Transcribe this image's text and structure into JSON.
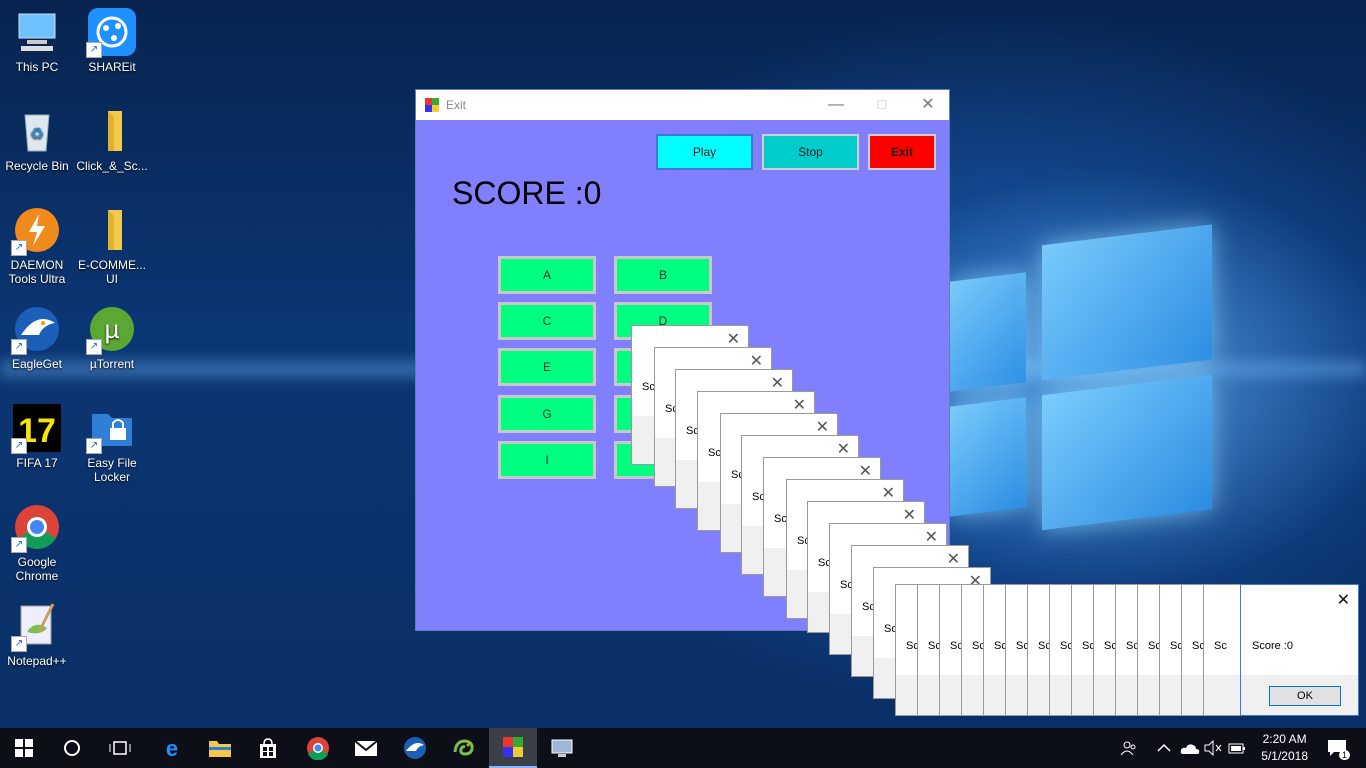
{
  "desktop": {
    "icons": [
      {
        "label": "This PC",
        "icon": "this-pc-icon"
      },
      {
        "label": "SHAREit",
        "icon": "shareit-icon"
      },
      {
        "label": "Recycle Bin",
        "icon": "recycle-bin-icon"
      },
      {
        "label": "Click_&_Sc...",
        "icon": "folder-icon"
      },
      {
        "label": "DAEMON Tools Ultra",
        "icon": "daemon-tools-icon"
      },
      {
        "label": "E-COMME... UI",
        "icon": "folder-icon"
      },
      {
        "label": "EagleGet",
        "icon": "eagleget-icon"
      },
      {
        "label": "µTorrent",
        "icon": "utorrent-icon"
      },
      {
        "label": "FIFA 17",
        "icon": "fifa-icon"
      },
      {
        "label": "Easy File Locker",
        "icon": "file-locker-icon"
      },
      {
        "label": "Google Chrome",
        "icon": "chrome-icon"
      },
      {
        "label": "Notepad++",
        "icon": "notepadpp-icon"
      }
    ]
  },
  "app": {
    "title": "Exit",
    "buttons": {
      "play": "Play",
      "stop": "Stop",
      "exit": "Exit"
    },
    "score": "SCORE :0",
    "grid_left": [
      "A",
      "C",
      "E",
      "G",
      "I"
    ],
    "grid_right": [
      "B",
      "D"
    ],
    "colors": {
      "background": "#8080ff",
      "play": "#00ffff",
      "stop": "#00cccc",
      "exit": "#ff0000",
      "grid": "#00ff80"
    }
  },
  "messagebox": {
    "partial_text": "Sc",
    "text": "Score :0",
    "ok": "OK",
    "close": "✕"
  },
  "taskbar": {
    "time": "2:20 AM",
    "date": "5/1/2018",
    "notification_count": "1"
  }
}
